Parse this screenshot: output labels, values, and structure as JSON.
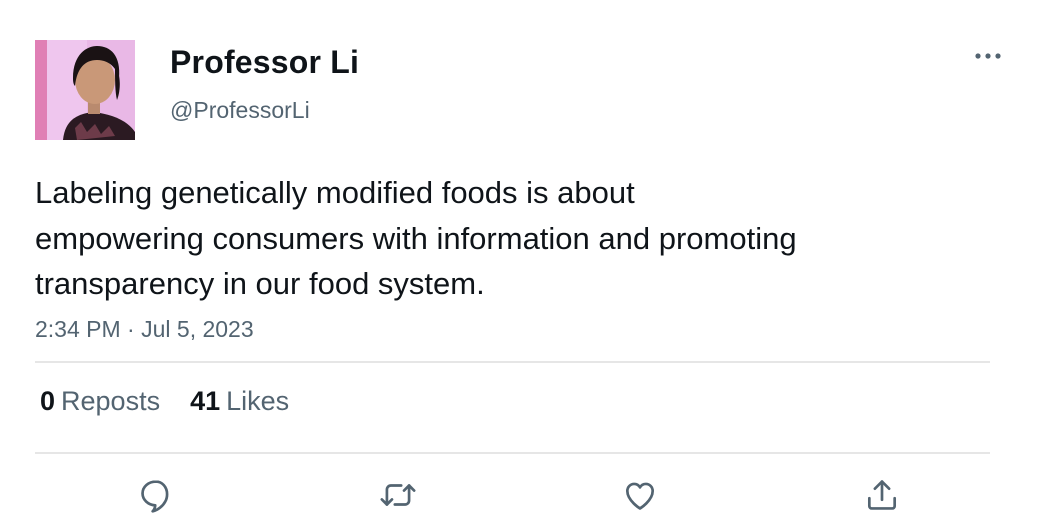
{
  "tweet": {
    "author": {
      "name": "Professor Li",
      "handle": "@ProfessorLi"
    },
    "text_lines": [
      "Labeling genetically modified foods is about",
      "empowering consumers with information and promoting",
      "transparency in our food system."
    ],
    "time": "2:34 PM",
    "separator": "·",
    "date": "Jul 5, 2023",
    "stats": {
      "reposts_count": "0",
      "reposts_label": "Reposts",
      "likes_count": "41",
      "likes_label": "Likes"
    },
    "actions": [
      "reply-icon",
      "repost-icon",
      "like-icon",
      "share-icon"
    ],
    "more_icon": "more-options-icon"
  },
  "colors": {
    "text": "#0f1419",
    "secondary": "#536471",
    "divider": "#e6e6e6",
    "icon": "#536471"
  }
}
